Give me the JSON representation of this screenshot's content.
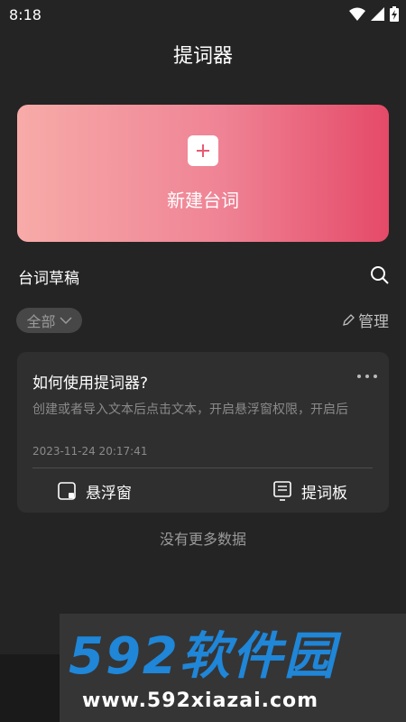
{
  "status_bar": {
    "time": "8:18"
  },
  "header": {
    "title": "提词器"
  },
  "create": {
    "label": "新建台词"
  },
  "section": {
    "title": "台词草稿"
  },
  "filter": {
    "selected": "全部"
  },
  "manage": {
    "label": "管理"
  },
  "draft": {
    "title": "如何使用提词器?",
    "preview": "创建或者导入文本后点击文本，开启悬浮窗权限，开启后",
    "time": "2023-11-24 20:17:41",
    "action_float": "悬浮窗",
    "action_prompter": "提词板"
  },
  "footer": {
    "no_more": "没有更多数据"
  },
  "watermark": {
    "logo": "592软件园",
    "url": "www.592xiazai.com"
  },
  "colors": {
    "accent_start": "#f7aba8",
    "accent_end": "#e54a68",
    "background": "#242424",
    "card": "#2f2f2f"
  }
}
